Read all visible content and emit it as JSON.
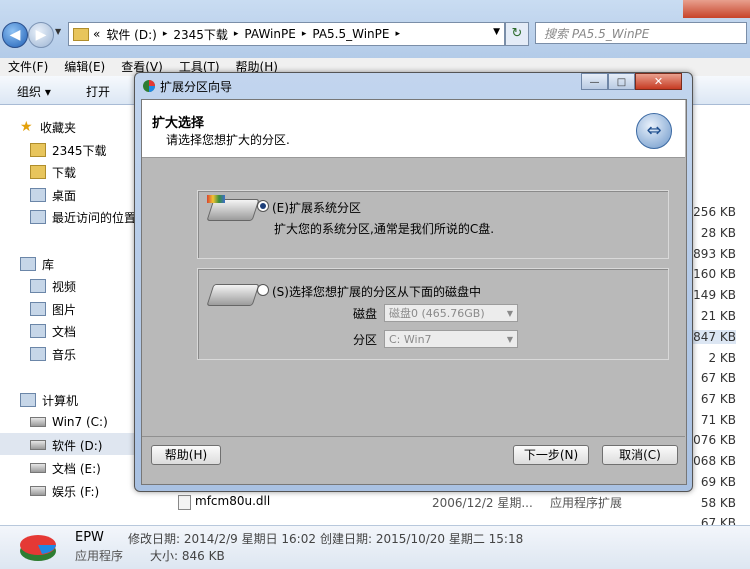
{
  "explorer": {
    "address": [
      "软件 (D:)",
      "2345下载",
      "PAWinPE",
      "PA5.5_WinPE"
    ],
    "address_prefix": "«",
    "search_placeholder": "搜索 PA5.5_WinPE",
    "menu": [
      "文件(F)",
      "编辑(E)",
      "查看(V)",
      "工具(T)",
      "帮助(H)"
    ],
    "toolbar": {
      "organize": "组织 ▾",
      "open": "打开"
    },
    "sidebar": {
      "favorites": "收藏夹",
      "fav_items": [
        "2345下载",
        "下载",
        "桌面",
        "最近访问的位置"
      ],
      "libraries": "库",
      "lib_items": [
        "视频",
        "图片",
        "文档",
        "音乐"
      ],
      "computer": "计算机",
      "drives": [
        "Win7 (C:)",
        "软件 (D:)",
        "文档 (E:)",
        "娱乐 (F:)"
      ]
    },
    "sizes": [
      "256 KB",
      "28 KB",
      "893 KB",
      "160 KB",
      "149 KB",
      "21 KB",
      "847 KB",
      "2 KB",
      "67 KB",
      "67 KB",
      "71 KB",
      "076 KB",
      "068 KB",
      "69 KB",
      "58 KB",
      "67 KB"
    ],
    "files": [
      {
        "name": "mfcm80u.dll",
        "date": "2006/12/2 星期...",
        "type": "应用程序扩展"
      }
    ],
    "status": {
      "name": "EPW",
      "kind": "应用程序",
      "modified": "修改日期: 2014/2/9 星期日 16:02",
      "created": "创建日期: 2015/10/20 星期二 15:18",
      "size": "大小: 846 KB"
    }
  },
  "dialog": {
    "title": "扩展分区向导",
    "header_title": "扩大选择",
    "header_subtitle": "请选择您想扩大的分区.",
    "option1_label": "(E)扩展系统分区",
    "option1_desc": "扩大您的系统分区,通常是我们所说的C盘.",
    "option2_label": "(S)选择您想扩展的分区从下面的磁盘中",
    "disk_label": "磁盘",
    "disk_value": "磁盘0 (465.76GB)",
    "partition_label": "分区",
    "partition_value": "C: Win7",
    "help_button": "帮助(H)",
    "next_button": "下一步(N)",
    "cancel_button": "取消(C)"
  }
}
